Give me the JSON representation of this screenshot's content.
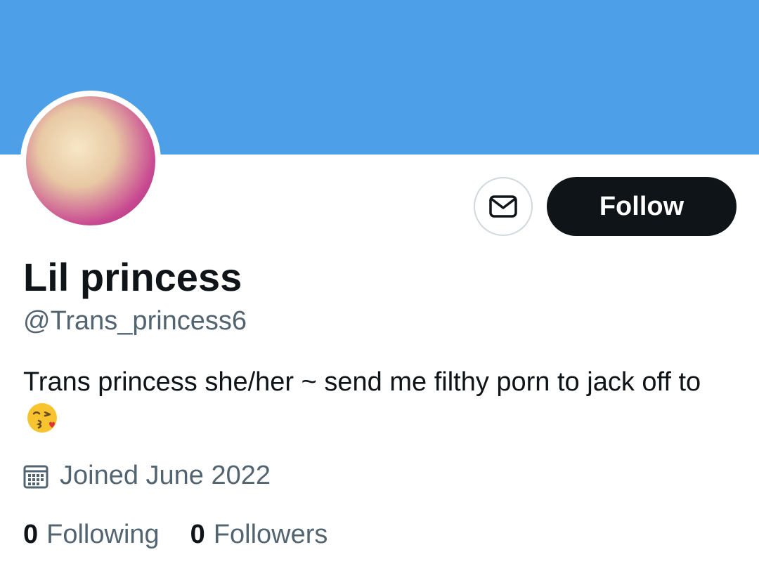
{
  "colors": {
    "banner": "#4d9fe8",
    "follow_bg": "#0f1419",
    "secondary_text": "#536471",
    "border": "#cfd9de"
  },
  "profile": {
    "name": "Lil princess",
    "handle": "@Trans_princess6",
    "bio": "Trans princess she/her ~ send me filthy porn to jack off to",
    "bio_emoji": "kissing-face-emoji",
    "joined": "Joined June 2022",
    "avatar": "profile-photo"
  },
  "actions": {
    "message_icon": "envelope-icon",
    "follow_label": "Follow"
  },
  "stats": {
    "following_count": "0",
    "following_label": "Following",
    "followers_count": "0",
    "followers_label": "Followers"
  }
}
